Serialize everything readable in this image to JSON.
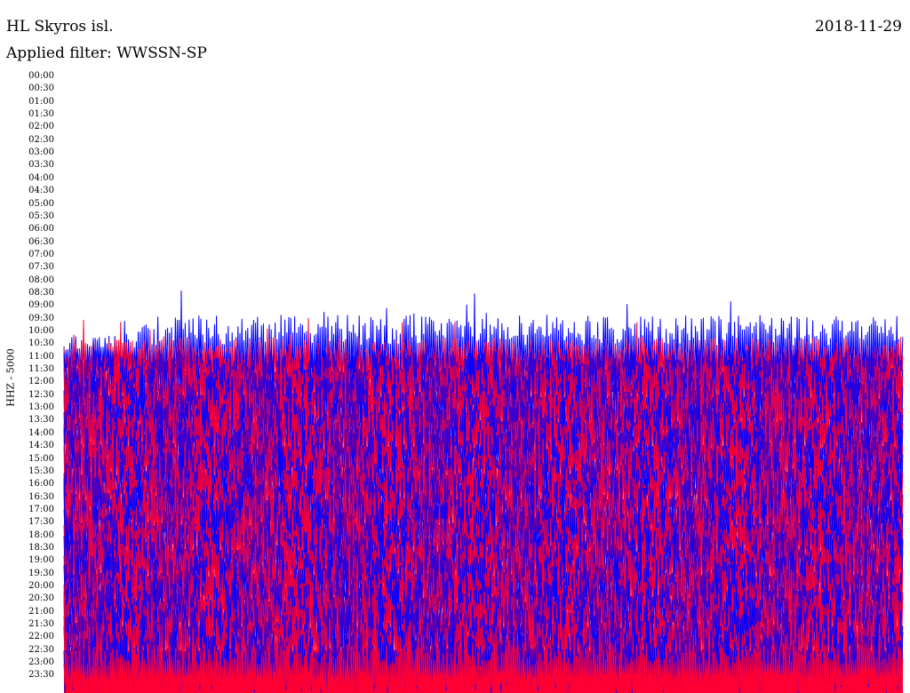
{
  "header": {
    "station": "HL Skyros isl.",
    "date": "2018-11-29",
    "filter": "Applied filter: WWSSN-SP"
  },
  "chart_data": {
    "type": "line",
    "title": "HL Skyros isl.",
    "ylabel": "HHZ - 5000",
    "y_ticks": [
      "00:00",
      "00:30",
      "01:00",
      "01:30",
      "02:00",
      "02:30",
      "03:00",
      "03:30",
      "04:00",
      "04:30",
      "05:00",
      "05:30",
      "06:00",
      "06:30",
      "07:00",
      "07:30",
      "08:00",
      "08:30",
      "09:00",
      "09:30",
      "10:00",
      "10:30",
      "11:00",
      "11:30",
      "12:00",
      "12:30",
      "13:00",
      "13:30",
      "14:00",
      "14:30",
      "15:00",
      "15:30",
      "16:00",
      "16:30",
      "17:00",
      "17:30",
      "18:00",
      "18:30",
      "19:00",
      "19:30",
      "20:00",
      "20:30",
      "21:00",
      "21:30",
      "22:00",
      "22:30",
      "23:00",
      "23:30"
    ],
    "series_colors": [
      "#0000ff",
      "#ff0033"
    ],
    "colors": {
      "a": "#0000ff",
      "b": "#ff0033"
    }
  }
}
